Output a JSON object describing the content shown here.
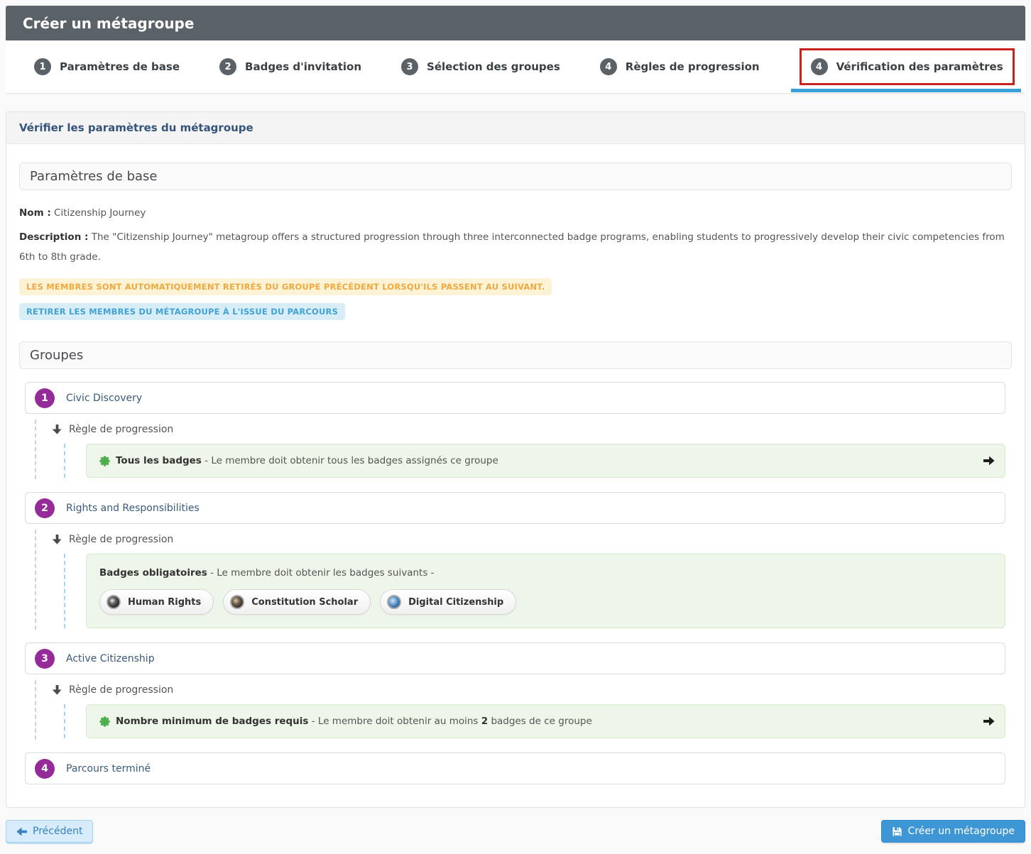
{
  "header": {
    "title": "Créer un métagroupe"
  },
  "steps": [
    {
      "number": "1",
      "label": "Paramètres de base"
    },
    {
      "number": "2",
      "label": "Badges d'invitation"
    },
    {
      "number": "3",
      "label": "Sélection des groupes"
    },
    {
      "number": "4",
      "label": "Règles de progression"
    },
    {
      "number": "4",
      "label": "Vérification des paramètres",
      "active": true
    }
  ],
  "panel": {
    "heading": "Vérifier les paramètres du métagroupe",
    "base_section": {
      "title": "Paramètres de base",
      "name_label": "Nom :",
      "name_value": "Citizenship Journey",
      "description_label": "Description :",
      "description_value": "The \"Citizenship Journey\" metagroup offers a structured progression through three interconnected badge programs, enabling students to progressively develop their civic competencies from 6th to 8th grade.",
      "warning_label": "LES MEMBRES SONT AUTOMATIQUEMENT RETIRÉS DU GROUPE PRÉCÉDENT LORSQU'ILS PASSENT AU SUIVANT.",
      "info_label": "RETIRER LES MEMBRES DU MÉTAGROUPE À L'ISSUE DU PARCOURS"
    },
    "groups_section": {
      "title": "Groupes",
      "rule_header_label": "Règle de progression",
      "groups": [
        {
          "number": "1",
          "name": "Civic Discovery",
          "rule": {
            "title": "Tous les badges",
            "text": "- Le membre doit obtenir tous les badges assignés ce groupe"
          }
        },
        {
          "number": "2",
          "name": "Rights and Responsibilities",
          "rule": {
            "title": "Badges obligatoires",
            "text": "- Le membre doit obtenir les badges suivants -",
            "badges": [
              "Human Rights",
              "Constitution Scholar",
              "Digital Citizenship"
            ]
          }
        },
        {
          "number": "3",
          "name": "Active Citizenship",
          "rule": {
            "title": "Nombre minimum de badges requis",
            "text_prefix": "- Le membre doit obtenir au moins ",
            "text_bold": "2",
            "text_suffix": " badges de ce groupe"
          }
        },
        {
          "number": "4",
          "name": "Parcours terminé"
        }
      ]
    }
  },
  "footer": {
    "previous_label": "Précédent",
    "create_label": "Créer un métagroupe"
  },
  "colors": {
    "header_bg": "#5a6268",
    "step_circle": "#5a6268",
    "active_underline": "#3aa0d8",
    "annotation_red": "#c9211e",
    "group_circle": "#942b99",
    "success_box_bg": "#eef5e9",
    "success_box_border": "#d6e9cc",
    "seal_green": "#4cae4c",
    "warning_label_bg": "#fcf3d7",
    "warning_label_text": "#f0a93e",
    "info_label_bg": "#d9edf7",
    "info_label_text": "#41a3d4",
    "primary_button_bg": "#3e97d5",
    "previous_button_bg": "#d7ebfa",
    "previous_button_text": "#3583c0"
  }
}
